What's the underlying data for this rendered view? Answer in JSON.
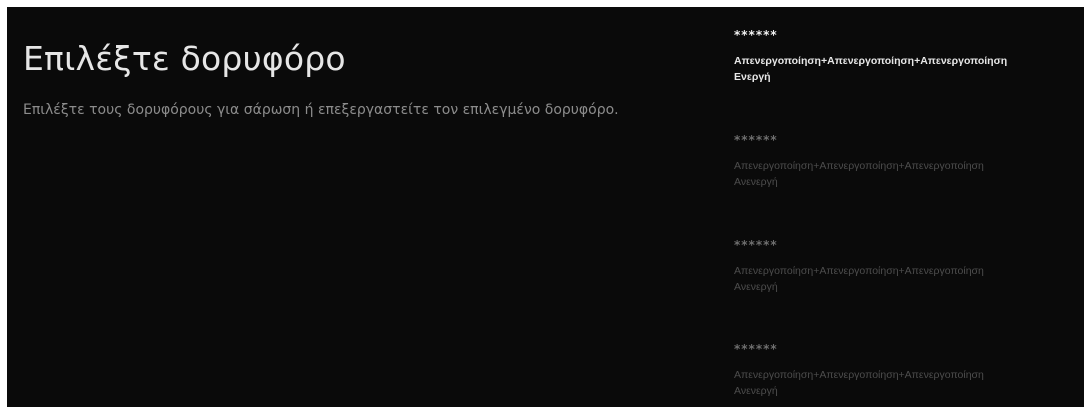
{
  "page": {
    "title": "Επιλέξτε δορυφόρο",
    "description": "Επιλέξτε τους δορυφόρους για σάρωση ή επεξεργαστείτε τον επιλεγμένο δορυφόρο."
  },
  "satellites": [
    {
      "name": "******",
      "status_line1": "Απενεργοποίηση+Απενεργοποίηση+Απενεργοποίηση",
      "status_line2": "Ενεργή"
    },
    {
      "name": "******",
      "status_line1": "Απενεργοποίηση+Απενεργοποίηση+Απενεργοποίηση",
      "status_line2": "Ανενεργή"
    },
    {
      "name": "******",
      "status_line1": "Απενεργοποίηση+Απενεργοποίηση+Απενεργοποίηση",
      "status_line2": "Ανενεργή"
    },
    {
      "name": "******",
      "status_line1": "Απενεργοποίηση+Απενεργοποίηση+Απενεργοποίηση",
      "status_line2": "Ανενεργή"
    }
  ],
  "colors": {
    "background": "#0a0a0a",
    "title": "#e6e6e6",
    "focused_text": "#f2f2f2",
    "dim_text": "#4d4d4d"
  }
}
